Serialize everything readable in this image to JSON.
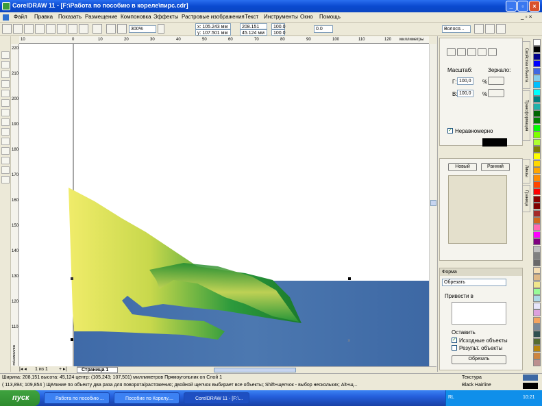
{
  "window": {
    "title": "CorelDRAW 11 - [F:\\Работа по пособию в кореле\\пирс.cdr]"
  },
  "menu": [
    "Файл",
    "Правка",
    "Показать",
    "Размещение",
    "Компоновка",
    "Эффекты",
    "Растровые изображения",
    "Текст",
    "Инструменты",
    "Окно",
    "Помощь"
  ],
  "toolbar": {
    "zoom": "300%",
    "x": "x: 105.243 мм",
    "y": "y: 107.501 мм",
    "w": "208.151 м...",
    "h": "45.124 мм",
    "sx": "100.0",
    "sy": "100.0",
    "angle": "0.0",
    "outline": "Волося..."
  },
  "hruler": {
    "unit": "миллиметры",
    "ticks": [
      "10",
      "0",
      "10",
      "20",
      "30",
      "40",
      "50",
      "60",
      "70",
      "80",
      "90",
      "100",
      "110",
      "120"
    ]
  },
  "vruler": {
    "ticks": [
      "220",
      "210",
      "200",
      "190",
      "180",
      "170",
      "160",
      "150",
      "140",
      "130",
      "120",
      "110"
    ],
    "unit": "миллиметры"
  },
  "pages": {
    "counter": "1 из 1",
    "tab": "Страница 1"
  },
  "transform": {
    "scale_label": "Масштаб:",
    "mirror_label": "Зеркало:",
    "h_label": "Г:",
    "v_label": "В:",
    "h": "100,0",
    "v": "100,0",
    "pct": "%",
    "nonprop": "Неравномерно"
  },
  "vtabs": [
    "Свойства объекта",
    "Трансформация",
    "Линзы",
    "Граница"
  ],
  "lens": {
    "new": "Новый",
    "early": "Ранний"
  },
  "shaping": {
    "title": "Форма",
    "mode": "Обрезать",
    "target_label": "Привести в",
    "keep_label": "Оставить",
    "source": "Исходные объекты",
    "result": "Результ. объекты",
    "apply": "Обрезать"
  },
  "status": {
    "line1": "Ширина: 208,151  высота: 45,124  центр: (105,243; 107,501)  миллиметров       Прямоугольник on Слой 1",
    "line2": "( 113,894; 109,854 )     Щёлкние по объекту два раза для поворота/растяжения; двойной щелчок выбирает все объекты; Shift+щелчок - выбор нескольких; Alt+щ...",
    "fill": "Текстура",
    "outline": "Black  Hairline"
  },
  "taskbar": {
    "start": "пуск",
    "tasks": [
      "Работа по пособию ...",
      "Пособие по Корелу....",
      "CorelDRAW 11 - [F:\\..."
    ],
    "lang": "RL",
    "time": "10:21"
  },
  "colors": {
    "palette": [
      "#ffffff",
      "#000000",
      "#00008b",
      "#0000ff",
      "#4169e1",
      "#87ceeb",
      "#00bfff",
      "#00ffff",
      "#008080",
      "#20b2aa",
      "#006400",
      "#008000",
      "#00ff00",
      "#7fff00",
      "#adff2f",
      "#808000",
      "#ffff00",
      "#ffd700",
      "#ffa500",
      "#ff8c00",
      "#ff4500",
      "#ff0000",
      "#8b0000",
      "#800000",
      "#a52a2a",
      "#d2691e",
      "#ff69b4",
      "#ff00ff",
      "#800080",
      "#c0c0c0",
      "#808080",
      "#696969",
      "#f5deb3",
      "#deb887",
      "#f0e68c",
      "#98fb98",
      "#add8e6",
      "#e6e6fa",
      "#dda0dd",
      "#f4a460",
      "#778899",
      "#2f4f4f",
      "#556b2f",
      "#b8860b",
      "#cd853f",
      "#bc8f8f"
    ]
  }
}
